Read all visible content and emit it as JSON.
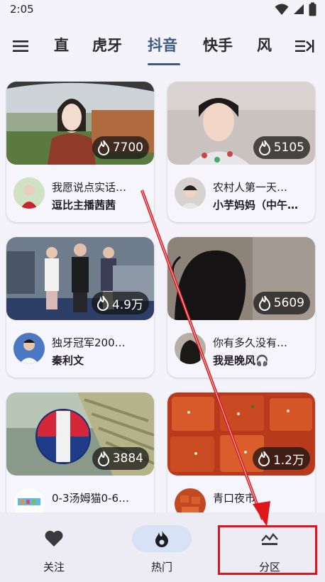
{
  "status_bar": {
    "time": "2:05"
  },
  "tabs": [
    {
      "label": "直"
    },
    {
      "label": "虎牙"
    },
    {
      "label": "抖音"
    },
    {
      "label": "快手"
    },
    {
      "label": "风"
    }
  ],
  "active_tab": "抖音",
  "cards": [
    {
      "title": "我愿说点实话…",
      "author": "逗比主播茜茜",
      "views": "7700"
    },
    {
      "title": "农村人第一天…",
      "author": "小芋妈妈（中午…",
      "views": "5105"
    },
    {
      "title": "独牙冠军200…",
      "author": "秦利文",
      "views": "4.9万"
    },
    {
      "title": "你有多久没有…",
      "author": "我是晚风🎧",
      "views": "5609"
    },
    {
      "title": "0-3汤姆猫0-6…",
      "author": "",
      "views": "3884"
    },
    {
      "title": "青口夜市",
      "author": "",
      "views": "1.2万"
    }
  ],
  "bottom_nav": [
    {
      "label": "关注",
      "icon": "heart-icon",
      "active": false
    },
    {
      "label": "热门",
      "icon": "flame-icon",
      "active": true
    },
    {
      "label": "分区",
      "icon": "category-icon",
      "active": false
    }
  ],
  "colors": {
    "accent": "#3c5a82",
    "annotation": "#e0141b",
    "nav_pill": "#d8e2f6",
    "background": "#f4f3fa"
  }
}
